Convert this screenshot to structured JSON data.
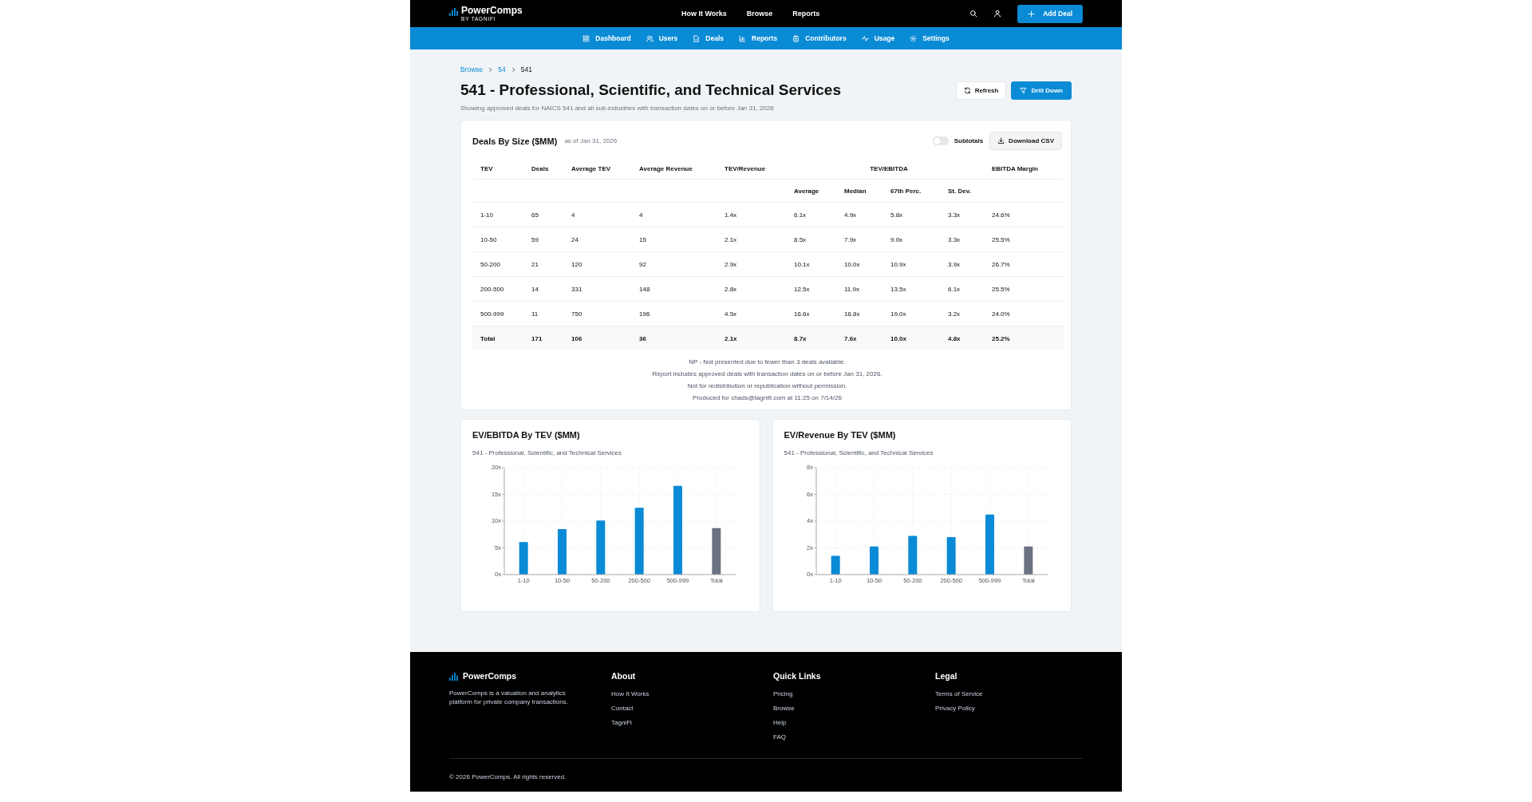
{
  "header": {
    "brand": "PowerComps",
    "brand_sub": "BY TAGNIFI",
    "links": [
      "How It Works",
      "Browse",
      "Reports"
    ],
    "add_button": "Add Deal"
  },
  "subnav": [
    "Dashboard",
    "Users",
    "Deals",
    "Reports",
    "Contributors",
    "Usage",
    "Settings"
  ],
  "breadcrumb": [
    "Browse",
    "54",
    "541"
  ],
  "page": {
    "title": "541 - Professional, Scientific, and Technical Services",
    "subtitle": "Showing approved deals for NAICS 541 and all sub-industries with transaction dates on or before Jan 31, 2026",
    "refresh_button": "Refresh",
    "drill_button": "Drill Down"
  },
  "table_card": {
    "title": "Deals By Size ($MM)",
    "as_of": "as of Jan 31, 2026",
    "subtotals": {
      "label": "Subtotals",
      "on": false
    },
    "download_button": "Download CSV",
    "columns": [
      {
        "label": "TEV"
      },
      {
        "label": "Deals"
      },
      {
        "label": "Average TEV"
      },
      {
        "label": "Average Revenue"
      },
      {
        "label": "TEV/Revenue"
      },
      {
        "label": "TEV/EBITDA",
        "colspan": 4
      },
      {
        "label": "EBITDA Margin"
      }
    ],
    "subcolumns": [
      "Average",
      "Median",
      "67th Perc.",
      "St. Dev."
    ],
    "rows": [
      {
        "kind": "data",
        "cells": [
          "1-10",
          "65",
          "4",
          "4",
          "1.4x",
          "6.1x",
          "4.9x",
          "5.8x",
          "3.3x",
          "24.6%"
        ]
      },
      {
        "kind": "data",
        "cells": [
          "10-50",
          "59",
          "24",
          "15",
          "2.1x",
          "8.5x",
          "7.9x",
          "9.0x",
          "3.3x",
          "25.5%"
        ]
      },
      {
        "kind": "data",
        "cells": [
          "50-200",
          "21",
          "120",
          "92",
          "2.9x",
          "10.1x",
          "10.0x",
          "10.9x",
          "3.9x",
          "26.7%"
        ]
      },
      {
        "kind": "data",
        "cells": [
          "200-500",
          "14",
          "331",
          "148",
          "2.8x",
          "12.5x",
          "11.9x",
          "13.5x",
          "6.1x",
          "25.5%"
        ]
      },
      {
        "kind": "data",
        "cells": [
          "500-999",
          "11",
          "750",
          "196",
          "4.5x",
          "16.6x",
          "16.8x",
          "19.0x",
          "3.2x",
          "24.0%"
        ]
      },
      {
        "kind": "total",
        "cells": [
          "Total",
          "171",
          "106",
          "36",
          "2.1x",
          "8.7x",
          "7.6x",
          "10.0x",
          "4.8x",
          "25.2%"
        ]
      }
    ],
    "notes": [
      "NP - Not presented due to fewer than 3 deals available.",
      "Report includes approved deals with transaction dates on or before Jan 31, 2026.",
      "Not for redistribution or republication without permission.",
      "Produced for chads@tagnifi.com at 11:25 on 7/14/26"
    ]
  },
  "charts": [
    {
      "title": "EV/EBITDA By TEV ($MM)",
      "subtitle": "541 - Professional, Scientific, and Technical Services",
      "chart_data": {
        "type": "bar",
        "categories": [
          "1-10",
          "10-50",
          "50-200",
          "200-500",
          "500-999",
          "Total"
        ],
        "series": [
          {
            "color": "#0a8bd6",
            "values": [
              6.1,
              8.5,
              10.1,
              12.5,
              16.6,
              null
            ]
          },
          {
            "color": "#6b7280",
            "values": [
              null,
              null,
              null,
              null,
              null,
              8.7
            ]
          }
        ],
        "grid": true,
        "ylim": [
          0,
          20
        ],
        "yticks": [
          {
            "value": 0,
            "label": "0x"
          },
          {
            "value": 5,
            "label": "5x"
          },
          {
            "value": 10,
            "label": "10x"
          },
          {
            "value": 15,
            "label": "15x"
          },
          {
            "value": 20,
            "label": "20x"
          }
        ]
      }
    },
    {
      "title": "EV/Revenue By TEV ($MM)",
      "subtitle": "541 - Professional, Scientific, and Technical Services",
      "chart_data": {
        "type": "bar",
        "categories": [
          "1-10",
          "10-50",
          "50-200",
          "200-500",
          "500-999",
          "Total"
        ],
        "series": [
          {
            "color": "#0a8bd6",
            "values": [
              1.4,
              2.1,
              2.9,
              2.8,
              4.5,
              null
            ]
          },
          {
            "color": "#6b7280",
            "values": [
              null,
              null,
              null,
              null,
              null,
              2.1
            ]
          }
        ],
        "grid": true,
        "ylim": [
          0,
          8
        ],
        "yticks": [
          {
            "value": 0,
            "label": "0x"
          },
          {
            "value": 2,
            "label": "2x"
          },
          {
            "value": 4,
            "label": "4x"
          },
          {
            "value": 6,
            "label": "6x"
          },
          {
            "value": 8,
            "label": "8x"
          }
        ]
      }
    }
  ],
  "footer": {
    "brand": "PowerComps",
    "description": "PowerComps is a valuation and analytics platform for private company transactions.",
    "columns": [
      {
        "heading": "About",
        "links": [
          "How It Works",
          "Contact",
          "TagniFi"
        ]
      },
      {
        "heading": "Quick Links",
        "links": [
          "Pricing",
          "Browse",
          "Help",
          "FAQ"
        ]
      },
      {
        "heading": "Legal",
        "links": [
          "Terms of Service",
          "Privacy Policy"
        ]
      }
    ],
    "copyright": "© 2026 PowerComps. All rights reserved."
  }
}
